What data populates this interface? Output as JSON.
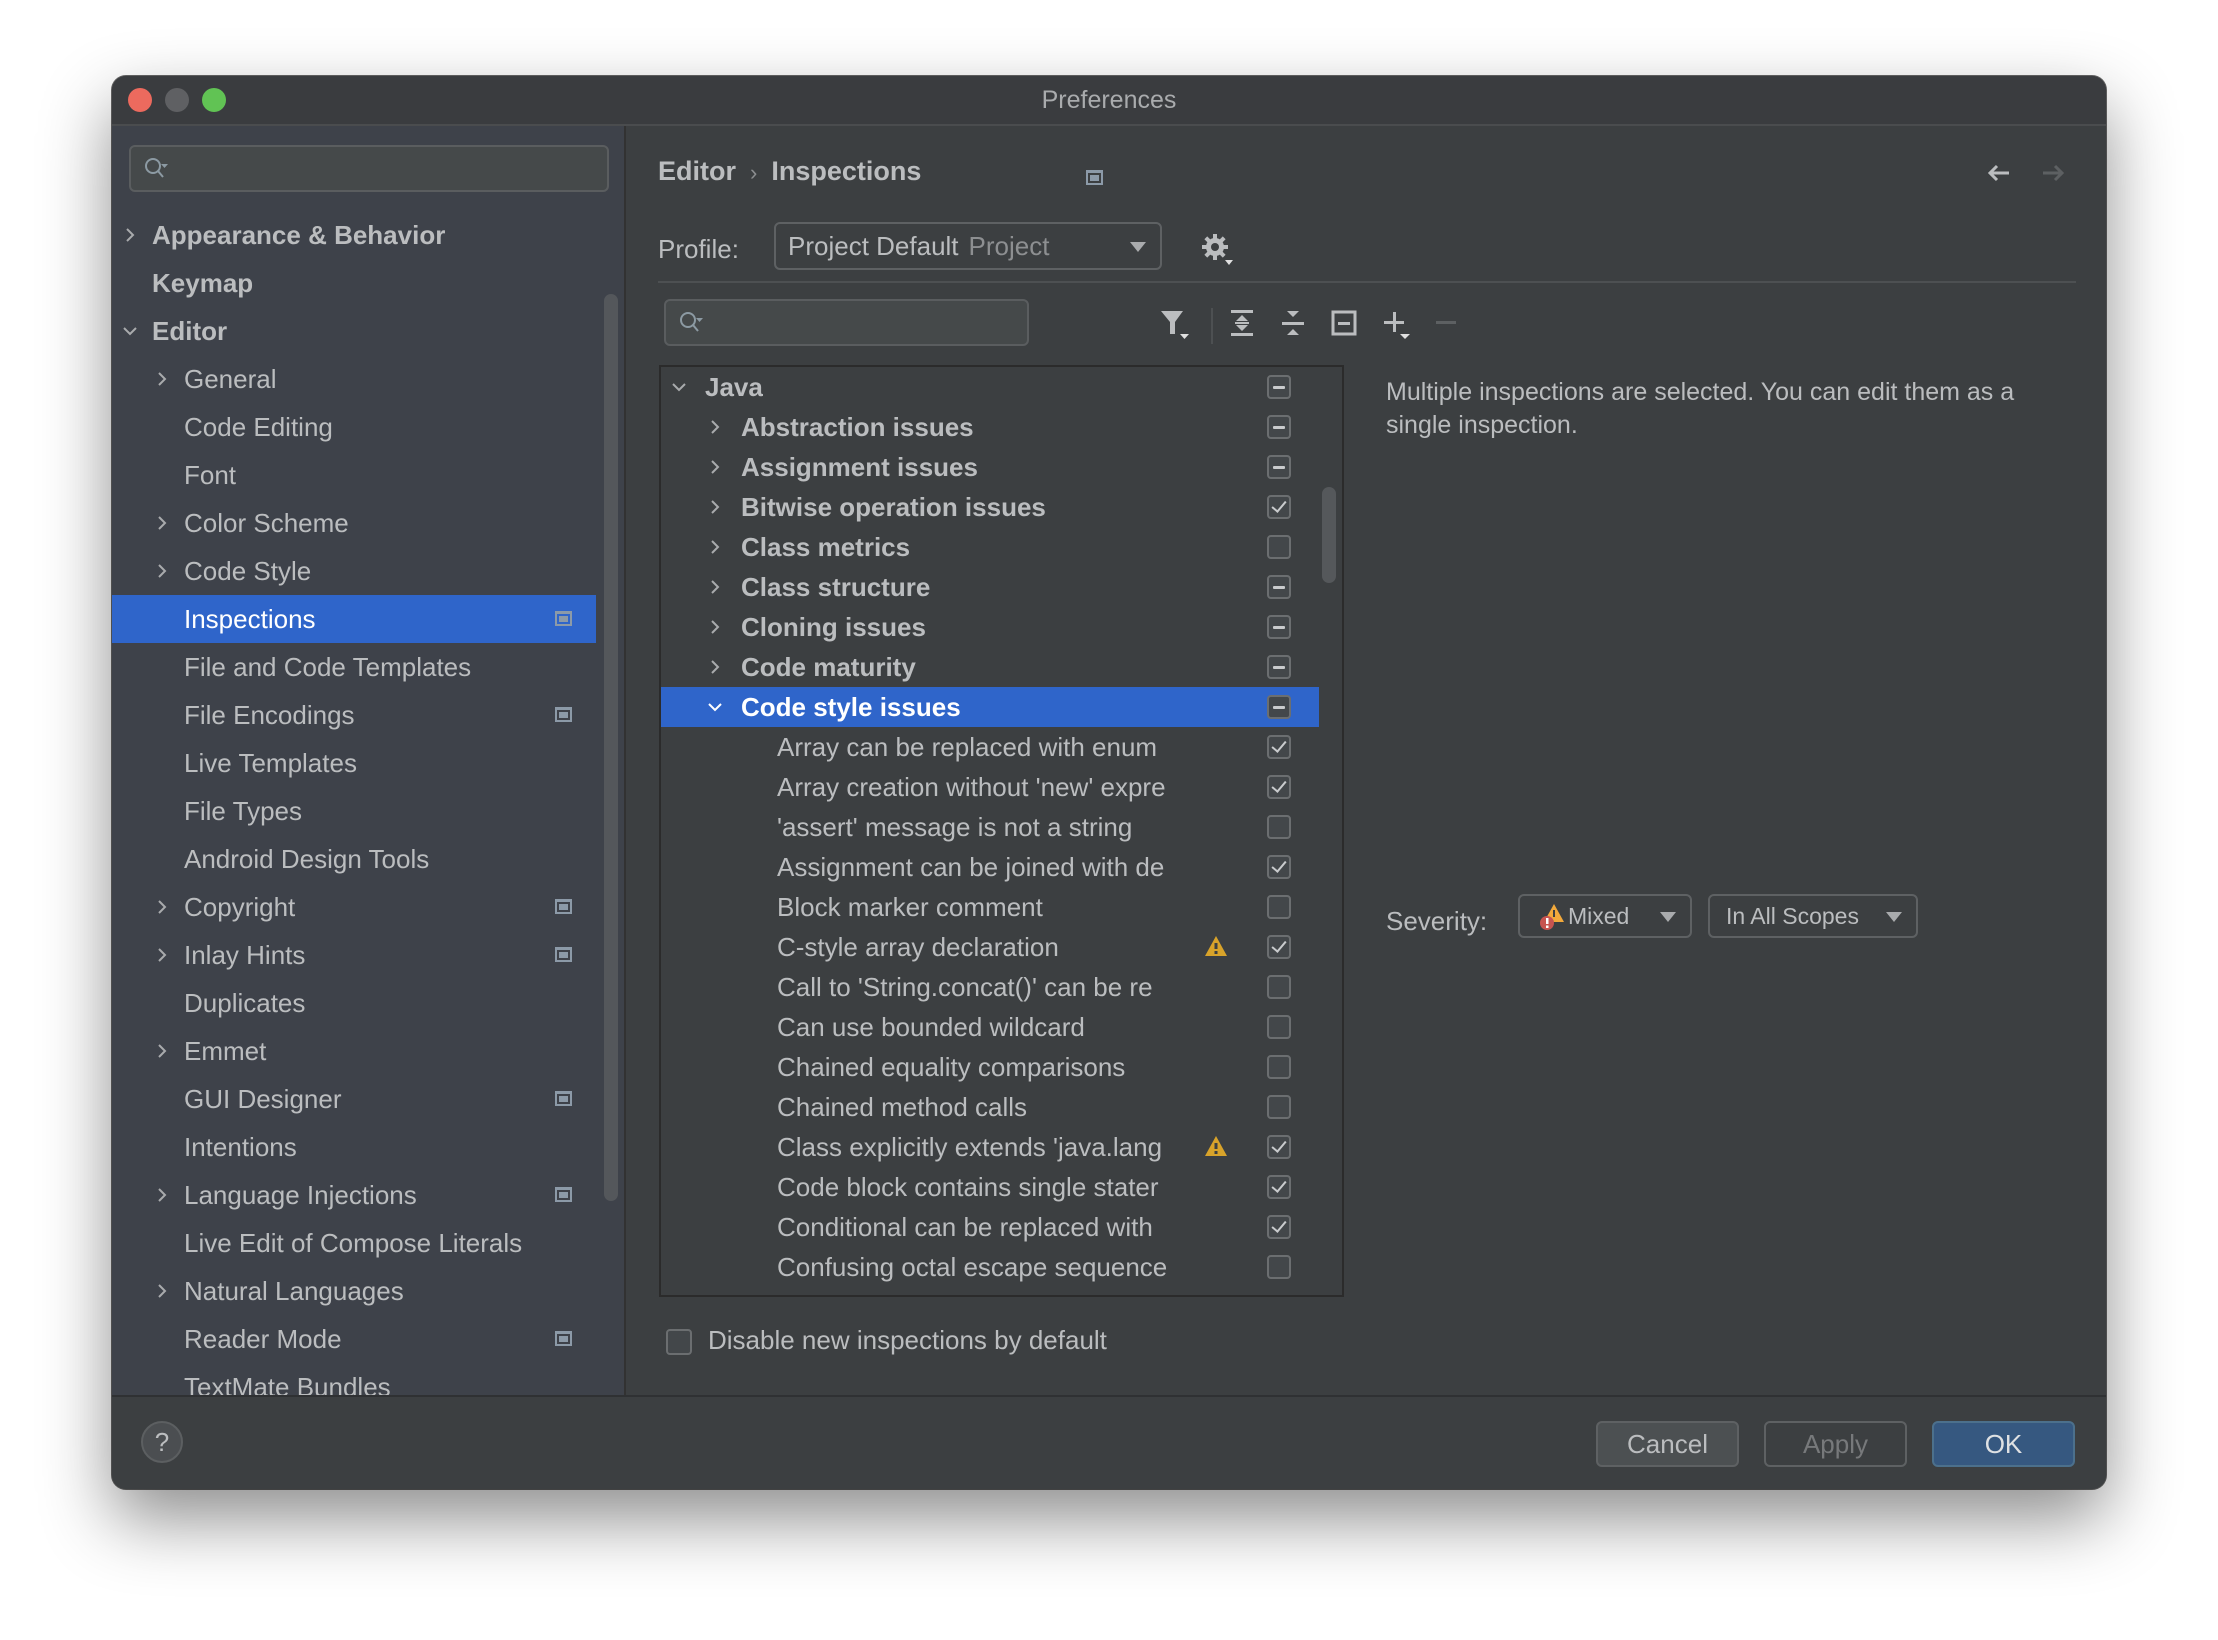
{
  "window": {
    "title": "Preferences"
  },
  "sidebar": {
    "search_placeholder": "",
    "items": [
      {
        "label": "Appearance & Behavior",
        "level": 0,
        "bold": true,
        "chevron": "right",
        "project_icon": false,
        "selected": false
      },
      {
        "label": "Keymap",
        "level": 0,
        "bold": true,
        "chevron": "none",
        "project_icon": false,
        "selected": false
      },
      {
        "label": "Editor",
        "level": 0,
        "bold": true,
        "chevron": "down",
        "project_icon": false,
        "selected": false
      },
      {
        "label": "General",
        "level": 1,
        "bold": false,
        "chevron": "right",
        "project_icon": false,
        "selected": false
      },
      {
        "label": "Code Editing",
        "level": 1,
        "bold": false,
        "chevron": "none",
        "project_icon": false,
        "selected": false
      },
      {
        "label": "Font",
        "level": 1,
        "bold": false,
        "chevron": "none",
        "project_icon": false,
        "selected": false
      },
      {
        "label": "Color Scheme",
        "level": 1,
        "bold": false,
        "chevron": "right",
        "project_icon": false,
        "selected": false
      },
      {
        "label": "Code Style",
        "level": 1,
        "bold": false,
        "chevron": "right",
        "project_icon": false,
        "selected": false
      },
      {
        "label": "Inspections",
        "level": 1,
        "bold": false,
        "chevron": "none",
        "project_icon": true,
        "selected": true
      },
      {
        "label": "File and Code Templates",
        "level": 1,
        "bold": false,
        "chevron": "none",
        "project_icon": false,
        "selected": false
      },
      {
        "label": "File Encodings",
        "level": 1,
        "bold": false,
        "chevron": "none",
        "project_icon": true,
        "selected": false
      },
      {
        "label": "Live Templates",
        "level": 1,
        "bold": false,
        "chevron": "none",
        "project_icon": false,
        "selected": false
      },
      {
        "label": "File Types",
        "level": 1,
        "bold": false,
        "chevron": "none",
        "project_icon": false,
        "selected": false
      },
      {
        "label": "Android Design Tools",
        "level": 1,
        "bold": false,
        "chevron": "none",
        "project_icon": false,
        "selected": false
      },
      {
        "label": "Copyright",
        "level": 1,
        "bold": false,
        "chevron": "right",
        "project_icon": true,
        "selected": false
      },
      {
        "label": "Inlay Hints",
        "level": 1,
        "bold": false,
        "chevron": "right",
        "project_icon": true,
        "selected": false
      },
      {
        "label": "Duplicates",
        "level": 1,
        "bold": false,
        "chevron": "none",
        "project_icon": false,
        "selected": false
      },
      {
        "label": "Emmet",
        "level": 1,
        "bold": false,
        "chevron": "right",
        "project_icon": false,
        "selected": false
      },
      {
        "label": "GUI Designer",
        "level": 1,
        "bold": false,
        "chevron": "none",
        "project_icon": true,
        "selected": false
      },
      {
        "label": "Intentions",
        "level": 1,
        "bold": false,
        "chevron": "none",
        "project_icon": false,
        "selected": false
      },
      {
        "label": "Language Injections",
        "level": 1,
        "bold": false,
        "chevron": "right",
        "project_icon": true,
        "selected": false
      },
      {
        "label": "Live Edit of Compose Literals",
        "level": 1,
        "bold": false,
        "chevron": "none",
        "project_icon": false,
        "selected": false
      },
      {
        "label": "Natural Languages",
        "level": 1,
        "bold": false,
        "chevron": "right",
        "project_icon": false,
        "selected": false
      },
      {
        "label": "Reader Mode",
        "level": 1,
        "bold": false,
        "chevron": "none",
        "project_icon": true,
        "selected": false
      },
      {
        "label": "TextMate Bundles",
        "level": 1,
        "bold": false,
        "chevron": "none",
        "project_icon": false,
        "selected": false
      }
    ]
  },
  "breadcrumb": {
    "parent": "Editor",
    "separator": "›",
    "current": "Inspections"
  },
  "nav": {
    "back_icon": "arrow-left-icon",
    "forward_icon": "arrow-right-icon"
  },
  "profile": {
    "label": "Profile:",
    "value": "Project Default",
    "scope": "Project"
  },
  "toolbar": {
    "search_placeholder": "",
    "icons": [
      "filter-icon",
      "expand-all-icon",
      "collapse-all-icon",
      "reset-icon",
      "add-icon",
      "remove-icon"
    ]
  },
  "tree": {
    "rows": [
      {
        "label": "Java",
        "level": 0,
        "group": true,
        "chevron": "down",
        "state": "mixed",
        "warning": false,
        "selected": false
      },
      {
        "label": "Abstraction issues",
        "level": 1,
        "group": true,
        "chevron": "right",
        "state": "mixed",
        "warning": false,
        "selected": false
      },
      {
        "label": "Assignment issues",
        "level": 1,
        "group": true,
        "chevron": "right",
        "state": "mixed",
        "warning": false,
        "selected": false
      },
      {
        "label": "Bitwise operation issues",
        "level": 1,
        "group": true,
        "chevron": "right",
        "state": "checked",
        "warning": false,
        "selected": false
      },
      {
        "label": "Class metrics",
        "level": 1,
        "group": true,
        "chevron": "right",
        "state": "unchecked",
        "warning": false,
        "selected": false
      },
      {
        "label": "Class structure",
        "level": 1,
        "group": true,
        "chevron": "right",
        "state": "mixed",
        "warning": false,
        "selected": false
      },
      {
        "label": "Cloning issues",
        "level": 1,
        "group": true,
        "chevron": "right",
        "state": "mixed",
        "warning": false,
        "selected": false
      },
      {
        "label": "Code maturity",
        "level": 1,
        "group": true,
        "chevron": "right",
        "state": "mixed",
        "warning": false,
        "selected": false
      },
      {
        "label": "Code style issues",
        "level": 1,
        "group": true,
        "chevron": "down",
        "state": "mixed",
        "warning": false,
        "selected": true
      },
      {
        "label": "Array can be replaced with enum",
        "level": 2,
        "group": false,
        "chevron": "none",
        "state": "checked",
        "warning": false,
        "selected": false
      },
      {
        "label": "Array creation without 'new' expre",
        "level": 2,
        "group": false,
        "chevron": "none",
        "state": "checked",
        "warning": false,
        "selected": false
      },
      {
        "label": "'assert' message is not a string",
        "level": 2,
        "group": false,
        "chevron": "none",
        "state": "unchecked",
        "warning": false,
        "selected": false
      },
      {
        "label": "Assignment can be joined with de",
        "level": 2,
        "group": false,
        "chevron": "none",
        "state": "checked",
        "warning": false,
        "selected": false
      },
      {
        "label": "Block marker comment",
        "level": 2,
        "group": false,
        "chevron": "none",
        "state": "unchecked",
        "warning": false,
        "selected": false
      },
      {
        "label": "C-style array declaration",
        "level": 2,
        "group": false,
        "chevron": "none",
        "state": "checked",
        "warning": true,
        "selected": false
      },
      {
        "label": "Call to 'String.concat()' can be re",
        "level": 2,
        "group": false,
        "chevron": "none",
        "state": "unchecked",
        "warning": false,
        "selected": false
      },
      {
        "label": "Can use bounded wildcard",
        "level": 2,
        "group": false,
        "chevron": "none",
        "state": "unchecked",
        "warning": false,
        "selected": false
      },
      {
        "label": "Chained equality comparisons",
        "level": 2,
        "group": false,
        "chevron": "none",
        "state": "unchecked",
        "warning": false,
        "selected": false
      },
      {
        "label": "Chained method calls",
        "level": 2,
        "group": false,
        "chevron": "none",
        "state": "unchecked",
        "warning": false,
        "selected": false
      },
      {
        "label": "Class explicitly extends 'java.lang",
        "level": 2,
        "group": false,
        "chevron": "none",
        "state": "checked",
        "warning": true,
        "selected": false
      },
      {
        "label": "Code block contains single stater",
        "level": 2,
        "group": false,
        "chevron": "none",
        "state": "checked",
        "warning": false,
        "selected": false
      },
      {
        "label": "Conditional can be replaced with",
        "level": 2,
        "group": false,
        "chevron": "none",
        "state": "checked",
        "warning": false,
        "selected": false
      },
      {
        "label": "Confusing octal escape sequence",
        "level": 2,
        "group": false,
        "chevron": "none",
        "state": "unchecked",
        "warning": false,
        "selected": false
      },
      {
        "label": "",
        "level": 2,
        "group": false,
        "chevron": "none",
        "state": "checked",
        "warning": false,
        "selected": false
      }
    ]
  },
  "description": "Multiple inspections are selected. You can edit them as a single inspection.",
  "severity": {
    "label": "Severity:",
    "value": "Mixed",
    "scope": "In All Scopes"
  },
  "disable_new": {
    "label": "Disable new inspections by default",
    "checked": false
  },
  "footer": {
    "help": "?",
    "cancel": "Cancel",
    "apply": "Apply",
    "ok": "OK"
  },
  "colors": {
    "selection": "#2f65ca",
    "ok_button": "#365880",
    "warning": "#d8a32a",
    "error": "#c75450"
  }
}
